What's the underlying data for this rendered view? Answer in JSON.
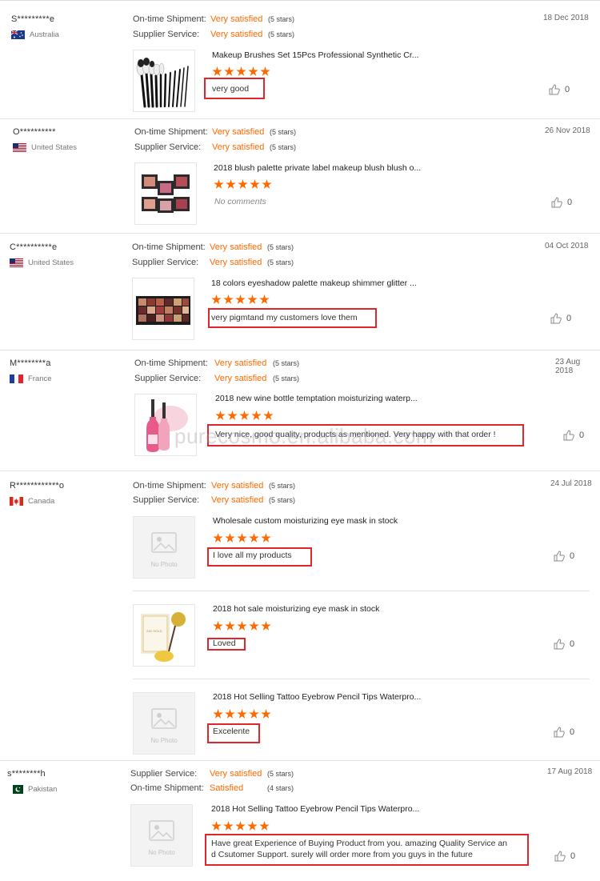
{
  "watermark": "purecosmo.en.alibaba.com",
  "reviews": [
    {
      "user": "S*********e",
      "country": "Australia",
      "date": "18 Dec 2018",
      "ratings": [
        {
          "label": "On-time Shipment:",
          "value": "Very satisfied",
          "stars": "(5 stars)"
        },
        {
          "label": "Supplier Service:",
          "value": "Very satisfied",
          "stars": "(5 stars)"
        }
      ],
      "items": [
        {
          "product": "Makeup Brushes Set 15Pcs Professional Synthetic Cr...",
          "stars": 5,
          "comment": "very good",
          "likes": "0",
          "image": "brushes"
        }
      ]
    },
    {
      "user": "O**********",
      "country": "United States",
      "date": "26 Nov 2018",
      "ratings": [
        {
          "label": "On-time Shipment:",
          "value": "Very satisfied",
          "stars": "(5 stars)"
        },
        {
          "label": "Supplier Service:",
          "value": "Very satisfied",
          "stars": "(5 stars)"
        }
      ],
      "items": [
        {
          "product": "2018 blush palette private label makeup blush blush o...",
          "stars": 5,
          "comment": "No comments",
          "likes": "0",
          "image": "blush"
        }
      ]
    },
    {
      "user": "C**********e",
      "country": "United States",
      "date": "04 Oct 2018",
      "ratings": [
        {
          "label": "On-time Shipment:",
          "value": "Very satisfied",
          "stars": "(5 stars)"
        },
        {
          "label": "Supplier Service:",
          "value": "Very satisfied",
          "stars": "(5 stars)"
        }
      ],
      "items": [
        {
          "product": "18 colors eyeshadow palette makeup shimmer glitter ...",
          "stars": 5,
          "comment": "very pigmtand my customers love them",
          "likes": "0",
          "image": "eyeshadow"
        }
      ]
    },
    {
      "user": "M********a",
      "country": "France",
      "date": "23 Aug 2018",
      "ratings": [
        {
          "label": "On-time Shipment:",
          "value": "Very satisfied",
          "stars": "(5 stars)"
        },
        {
          "label": "Supplier Service:",
          "value": "Very satisfied",
          "stars": "(5 stars)"
        }
      ],
      "items": [
        {
          "product": "2018 new wine bottle temptation moisturizing waterp...",
          "stars": 5,
          "comment": "Very nice, good quality, products as mentioned. Very happy with that order !",
          "likes": "0",
          "image": "lipstick"
        }
      ]
    },
    {
      "user": "R************o",
      "country": "Canada",
      "date": "24 Jul 2018",
      "ratings": [
        {
          "label": "On-time Shipment:",
          "value": "Very satisfied",
          "stars": "(5 stars)"
        },
        {
          "label": "Supplier Service:",
          "value": "Very satisfied",
          "stars": "(5 stars)"
        }
      ],
      "items": [
        {
          "product": "Wholesale custom moisturizing eye mask in stock",
          "stars": 5,
          "comment": "I love all my products",
          "likes": "0",
          "image": "nophoto"
        },
        {
          "product": "2018 hot sale moisturizing eye mask in stock",
          "stars": 5,
          "comment": "Loved",
          "likes": "0",
          "image": "eyemask"
        },
        {
          "product": "2018 Hot Selling Tattoo Eyebrow Pencil Tips Waterpro...",
          "stars": 5,
          "comment": "Excelente",
          "likes": "0",
          "image": "nophoto"
        }
      ]
    },
    {
      "user": "s********h",
      "country": "Pakistan",
      "date": "17 Aug 2018",
      "ratings": [
        {
          "label": "Supplier Service:",
          "value": "Very satisfied",
          "stars": "(5 stars)"
        },
        {
          "label": "On-time Shipment:",
          "value": "Satisfied",
          "stars": "(4 stars)"
        }
      ],
      "items": [
        {
          "product": "2018 Hot Selling Tattoo Eyebrow Pencil Tips Waterpro...",
          "stars": 5,
          "comment_line1": "Have great Experience of Buying Product from you. amazing Quality Service an",
          "comment_line2": "d Csutomer Support. surely will order more from you guys in the future",
          "likes": "0",
          "image": "nophoto"
        }
      ]
    }
  ],
  "no_photo_label": "No Photo",
  "colors": {
    "accent": "#ff6a00",
    "highlight_box": "#e0262d"
  }
}
